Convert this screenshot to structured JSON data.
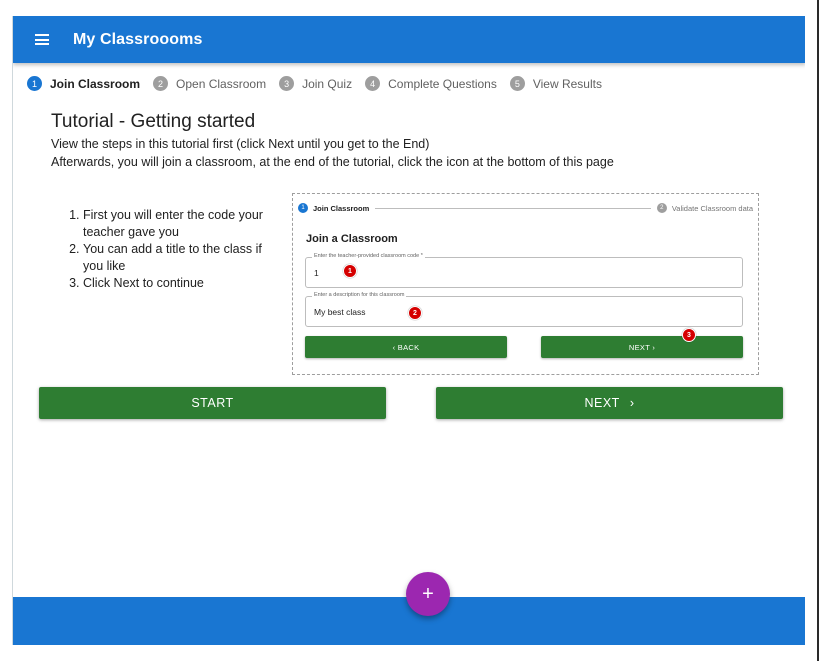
{
  "app": {
    "title": "My Classroooms"
  },
  "stepper": {
    "steps": [
      {
        "number": "1",
        "label": "Join Classroom"
      },
      {
        "number": "2",
        "label": "Open Classroom"
      },
      {
        "number": "3",
        "label": "Join Quiz"
      },
      {
        "number": "4",
        "label": "Complete Questions"
      },
      {
        "number": "5",
        "label": "View Results"
      }
    ]
  },
  "tutorial": {
    "title": "Tutorial - Getting started",
    "line1": "View the steps in this tutorial first (click Next until you get to the End)",
    "line2": "Afterwards, you will join a classroom, at the end of the tutorial, click the icon at the bottom of this page",
    "instructions": [
      "First you will enter the code your teacher gave you",
      "You can add a title to the class if you like",
      "Click Next to continue"
    ]
  },
  "preview": {
    "step1_number": "1",
    "step1_label": "Join Classroom",
    "step2_number": "2",
    "step2_label": "Validate Classroom data",
    "heading": "Join a Classroom",
    "code_field": {
      "label": "Enter the teacher-provided classroom code *",
      "value": "1"
    },
    "description_field": {
      "label": "Enter a description for this classroom",
      "value": "My best class"
    },
    "back_label": "‹  BACK",
    "next_label": "NEXT  ›",
    "badges": [
      "1",
      "2",
      "3"
    ]
  },
  "actions": {
    "start_label": "START",
    "next_label": "NEXT",
    "next_chevron": "›"
  },
  "fab": {
    "icon": "plus-icon",
    "glyph": "+"
  },
  "colors": {
    "primary": "#1976d2",
    "action": "#2e7d32",
    "fab": "#9c27b0",
    "badge": "#d50000"
  }
}
